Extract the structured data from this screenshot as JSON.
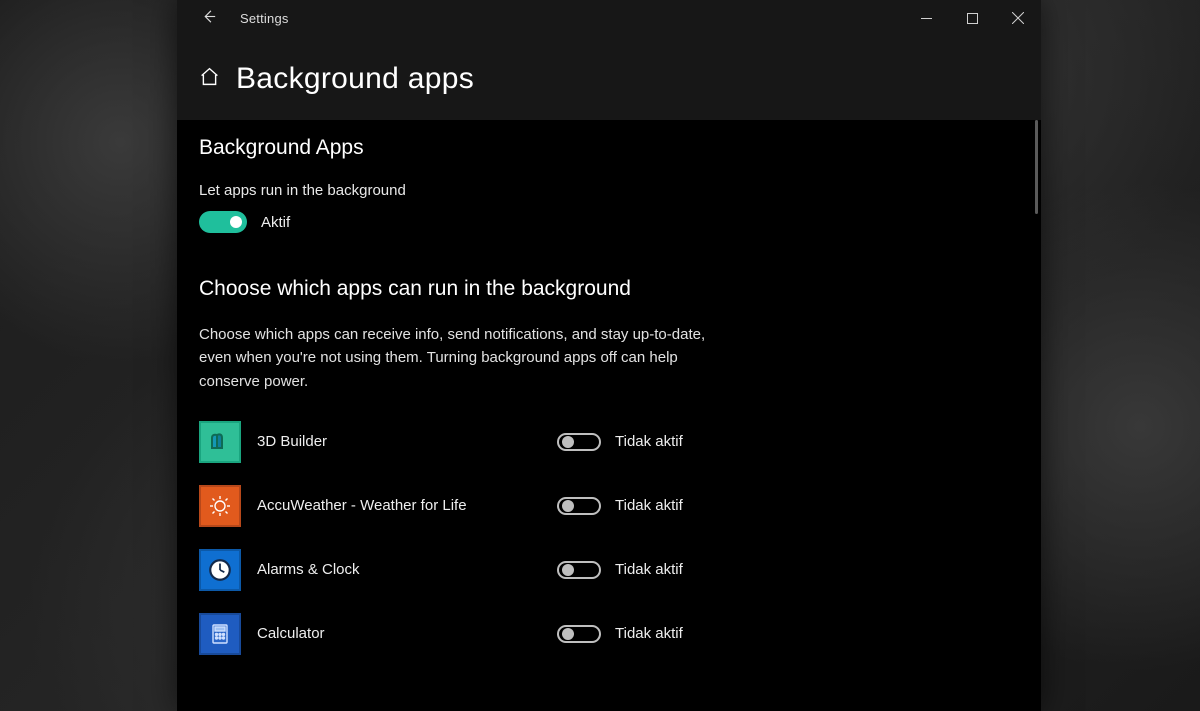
{
  "titlebar": {
    "title": "Settings"
  },
  "header": {
    "page_title": "Background apps"
  },
  "section1": {
    "heading": "Background Apps",
    "setting_label": "Let apps run in the background",
    "toggle_state_label": "Aktif"
  },
  "section2": {
    "heading": "Choose which apps can run in the background",
    "description": "Choose which apps can receive info, send notifications, and stay up-to-date, even when you're not using them. Turning background apps off can help conserve power."
  },
  "apps": [
    {
      "name": "3D Builder",
      "state_label": "Tidak aktif",
      "icon": "builder"
    },
    {
      "name": "AccuWeather - Weather for Life",
      "state_label": "Tidak aktif",
      "icon": "accu"
    },
    {
      "name": "Alarms & Clock",
      "state_label": "Tidak aktif",
      "icon": "alarm"
    },
    {
      "name": "Calculator",
      "state_label": "Tidak aktif",
      "icon": "calc"
    }
  ]
}
